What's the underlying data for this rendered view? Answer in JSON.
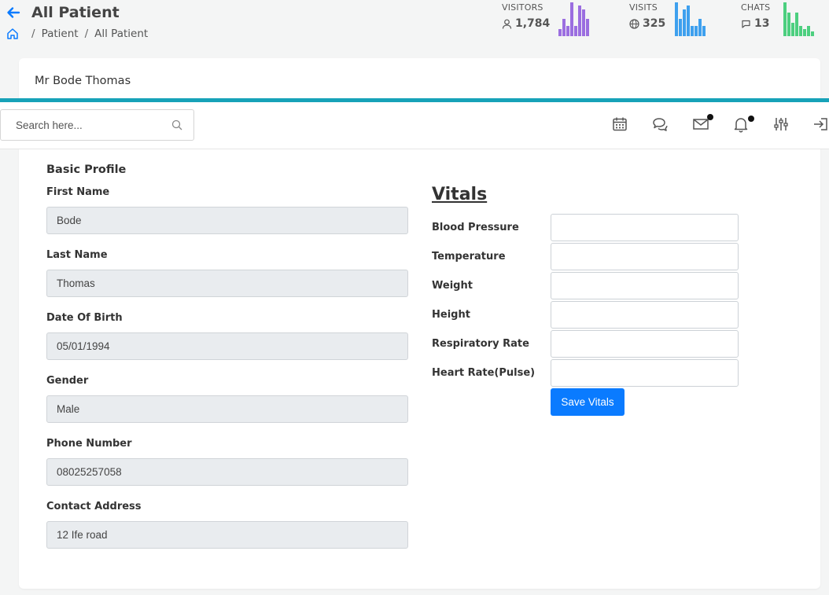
{
  "header": {
    "title": "All Patient",
    "breadcrumb": [
      "Patient",
      "All Patient"
    ]
  },
  "stats": [
    {
      "label": "VISITORS",
      "value": "1,784",
      "icon": "user-icon",
      "color": "#9b6ee0",
      "bars": [
        0.2,
        0.5,
        0.3,
        1.0,
        0.3,
        0.9,
        0.8,
        0.5
      ]
    },
    {
      "label": "VISITS",
      "value": "325",
      "icon": "globe-icon",
      "color": "#3ea0ee",
      "bars": [
        1.0,
        0.5,
        0.8,
        0.9,
        0.3,
        0.3,
        0.5,
        0.3
      ]
    },
    {
      "label": "CHATS",
      "value": "13",
      "icon": "chat-icon",
      "color": "#4ccf7f",
      "bars": [
        1.0,
        0.7,
        0.4,
        0.7,
        0.3,
        0.2,
        0.3,
        0.15
      ]
    }
  ],
  "card": {
    "title": "Mr Bode Thomas"
  },
  "search": {
    "placeholder": "Search here..."
  },
  "profile": {
    "section_title": "Basic Profile",
    "fields": [
      {
        "label": "First Name",
        "value": "Bode"
      },
      {
        "label": "Last Name",
        "value": "Thomas"
      },
      {
        "label": "Date Of Birth",
        "value": "05/01/1994"
      },
      {
        "label": "Gender",
        "value": "Male"
      },
      {
        "label": "Phone Number",
        "value": "08025257058"
      },
      {
        "label": "Contact Address",
        "value": "12 Ife road"
      }
    ]
  },
  "vitals": {
    "title": "Vitals",
    "fields": [
      "Blood Pressure",
      "Temperature",
      "Weight",
      "Height",
      "Respiratory Rate",
      "Heart Rate(Pulse)"
    ],
    "save_label": "Save Vitals"
  },
  "colors": {
    "accent": "#17a2b8",
    "primary": "#0a7bff"
  }
}
